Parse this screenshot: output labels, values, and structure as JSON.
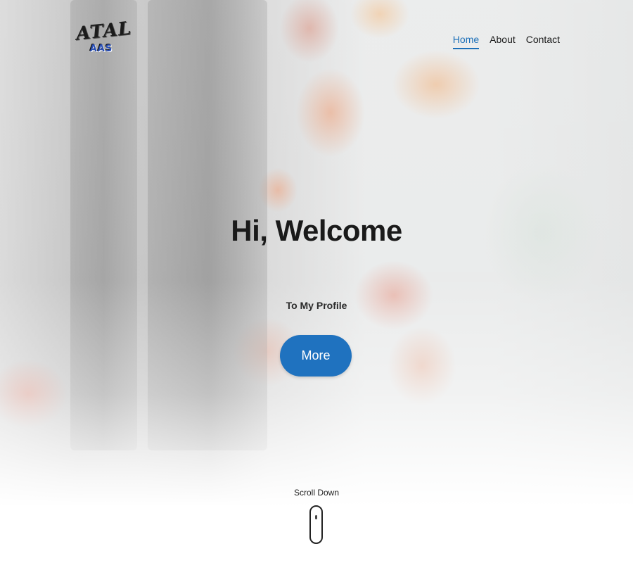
{
  "header": {
    "logo_text": "ATAL",
    "logo_sub": "AAS",
    "nav": [
      {
        "label": "Home",
        "active": true
      },
      {
        "label": "About",
        "active": false
      },
      {
        "label": "Contact",
        "active": false
      }
    ]
  },
  "hero": {
    "title": "Hi, Welcome",
    "subtitle": "To My Profile",
    "button_label": "More"
  },
  "scroll": {
    "label": "Scroll Down"
  },
  "colors": {
    "accent": "#1f72bf",
    "text": "#1a1a1a"
  }
}
